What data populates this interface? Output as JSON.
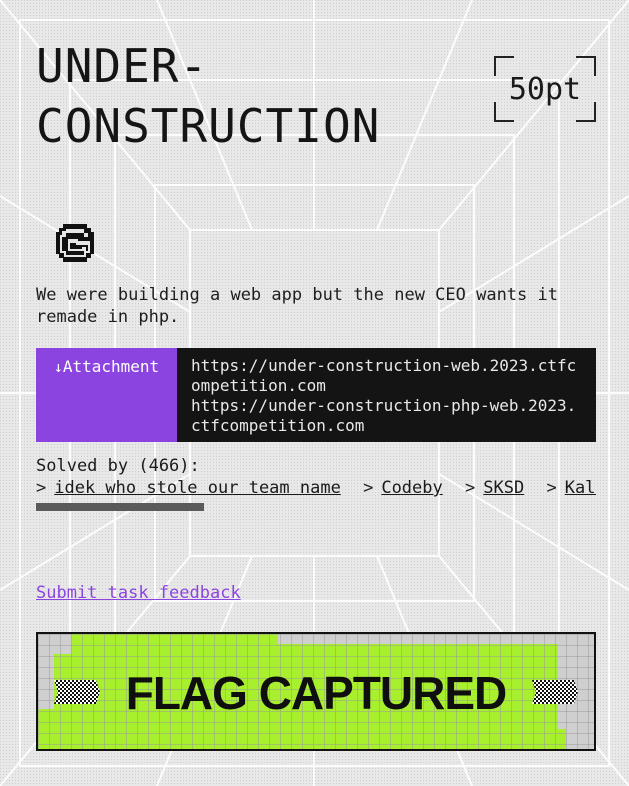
{
  "challenge": {
    "title": "UNDER-\nCONSTRUCTION",
    "points": "50pt",
    "category_icon": "spiral-icon",
    "description": "We were building a web app but the new CEO wants it remade in php."
  },
  "attachment": {
    "button_label": "Attachment",
    "button_icon": "download-arrow-icon",
    "links": [
      "https://under-construction-web.2023.ctfcompetition.com",
      "https://under-construction-php-web.2023.ctfcompetition.com"
    ]
  },
  "solves": {
    "label": "Solved by (466):",
    "separator": ">",
    "teams": [
      "idek who stole our team name",
      "Codeby",
      "SKSD",
      "Kalma"
    ]
  },
  "feedback_link": "Submit task feedback",
  "flag_status": "FLAG CAPTURED",
  "colors": {
    "accent_purple": "#8c44e0",
    "flag_green": "#a8f02e",
    "dark": "#141414",
    "background": "#e6e6e6"
  }
}
